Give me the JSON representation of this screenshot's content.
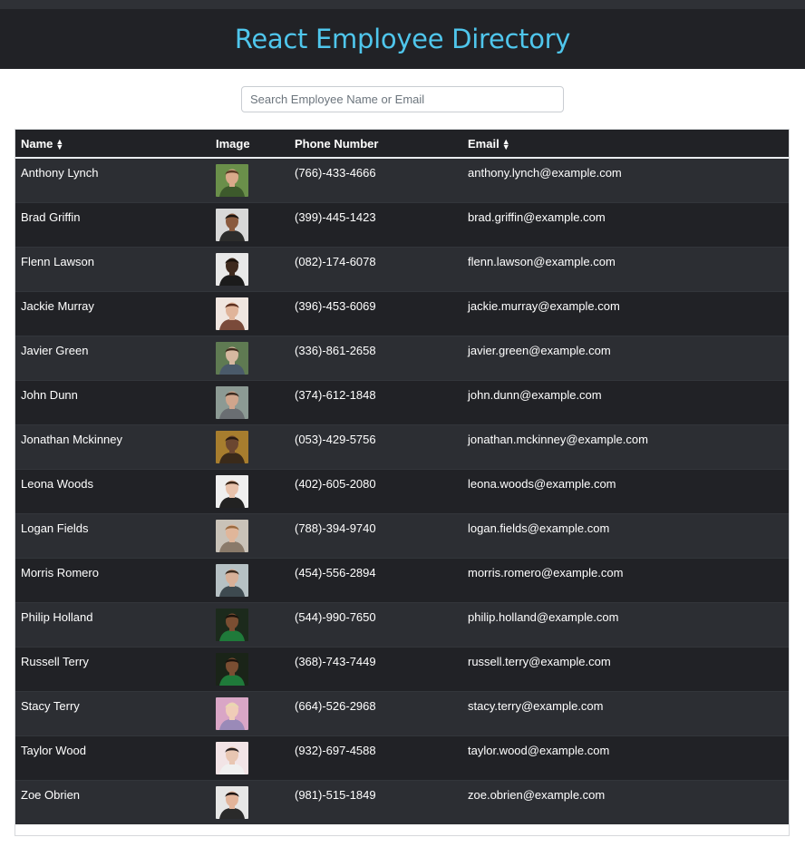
{
  "header": {
    "title": "React Employee Directory"
  },
  "search": {
    "placeholder": "Search Employee Name or Email"
  },
  "table": {
    "columns": [
      {
        "label": "Name",
        "sortable": true
      },
      {
        "label": "Image",
        "sortable": false
      },
      {
        "label": "Phone Number",
        "sortable": false
      },
      {
        "label": "Email",
        "sortable": true
      }
    ],
    "rows": [
      {
        "name": "Anthony Lynch",
        "phone": "(766)-433-4666",
        "email": "anthony.lynch@example.com",
        "photo": {
          "bg": "#6a8f4a",
          "skin": "#d9a98a",
          "hair": "#5a3b24",
          "shirt": "#3d5a2c"
        }
      },
      {
        "name": "Brad Griffin",
        "phone": "(399)-445-1423",
        "email": "brad.griffin@example.com",
        "photo": {
          "bg": "#d8d8d8",
          "skin": "#8a5a3e",
          "hair": "#1a1410",
          "shirt": "#2c2c2c"
        }
      },
      {
        "name": "Flenn Lawson",
        "phone": "(082)-174-6078",
        "email": "flenn.lawson@example.com",
        "photo": {
          "bg": "#e8e8e8",
          "skin": "#3e2a1e",
          "hair": "#1a120c",
          "shirt": "#1b1b1b"
        }
      },
      {
        "name": "Jackie Murray",
        "phone": "(396)-453-6069",
        "email": "jackie.murray@example.com",
        "photo": {
          "bg": "#f0e6e0",
          "skin": "#e0b49a",
          "hair": "#5b2e1e",
          "shirt": "#7a4a3a"
        }
      },
      {
        "name": "Javier Green",
        "phone": "(336)-861-2658",
        "email": "javier.green@example.com",
        "photo": {
          "bg": "#5f7a52",
          "skin": "#d6b8a0",
          "hair": "#3e2a1c",
          "shirt": "#4a5a6a"
        }
      },
      {
        "name": "John Dunn",
        "phone": "(374)-612-1848",
        "email": "john.dunn@example.com",
        "photo": {
          "bg": "#8c9a94",
          "skin": "#cfa58c",
          "hair": "#3a2a20",
          "shirt": "#6a6e72"
        }
      },
      {
        "name": "Jonathan Mckinney",
        "phone": "(053)-429-5756",
        "email": "jonathan.mckinney@example.com",
        "photo": {
          "bg": "#a77d2e",
          "skin": "#6b4630",
          "hair": "#2a1a10",
          "shirt": "#3a2a1a"
        }
      },
      {
        "name": "Leona Woods",
        "phone": "(402)-605-2080",
        "email": "leona.woods@example.com",
        "photo": {
          "bg": "#efefef",
          "skin": "#e8c2ab",
          "hair": "#3a2618",
          "shirt": "#222222"
        }
      },
      {
        "name": "Logan Fields",
        "phone": "(788)-394-9740",
        "email": "logan.fields@example.com",
        "photo": {
          "bg": "#c9c2b8",
          "skin": "#e0b69a",
          "hair": "#9a6a40",
          "shirt": "#8a7a6a"
        }
      },
      {
        "name": "Morris Romero",
        "phone": "(454)-556-2894",
        "email": "morris.romero@example.com",
        "photo": {
          "bg": "#b6c1c4",
          "skin": "#d8b098",
          "hair": "#3a2a1e",
          "shirt": "#3e4a50"
        }
      },
      {
        "name": "Philip Holland",
        "phone": "(544)-990-7650",
        "email": "philip.holland@example.com",
        "photo": {
          "bg": "#1c2a1c",
          "skin": "#7a4e32",
          "hair": "#1a120c",
          "shirt": "#1f7a3a"
        }
      },
      {
        "name": "Russell Terry",
        "phone": "(368)-743-7449",
        "email": "russell.terry@example.com",
        "photo": {
          "bg": "#1a2418",
          "skin": "#7a4e32",
          "hair": "#1a120c",
          "shirt": "#1f7a3a"
        }
      },
      {
        "name": "Stacy Terry",
        "phone": "(664)-526-2968",
        "email": "stacy.terry@example.com",
        "photo": {
          "bg": "#d9a6c6",
          "skin": "#f0cdb8",
          "hair": "#e8d8b0",
          "shirt": "#9a8ab8"
        }
      },
      {
        "name": "Taylor Wood",
        "phone": "(932)-697-4588",
        "email": "taylor.wood@example.com",
        "photo": {
          "bg": "#f2e4e6",
          "skin": "#e8c6b2",
          "hair": "#2a2222",
          "shirt": "#f0f0f0"
        }
      },
      {
        "name": "Zoe Obrien",
        "phone": "(981)-515-1849",
        "email": "zoe.obrien@example.com",
        "photo": {
          "bg": "#e6e6e6",
          "skin": "#e2b49a",
          "hair": "#1a1210",
          "shirt": "#2a2a2a"
        }
      }
    ]
  },
  "colors": {
    "header_bg": "#212226",
    "title": "#4fc6ec",
    "row_odd": "#2c2e33",
    "row_even": "#212226"
  },
  "icons": {
    "sort": "sort-icon"
  }
}
